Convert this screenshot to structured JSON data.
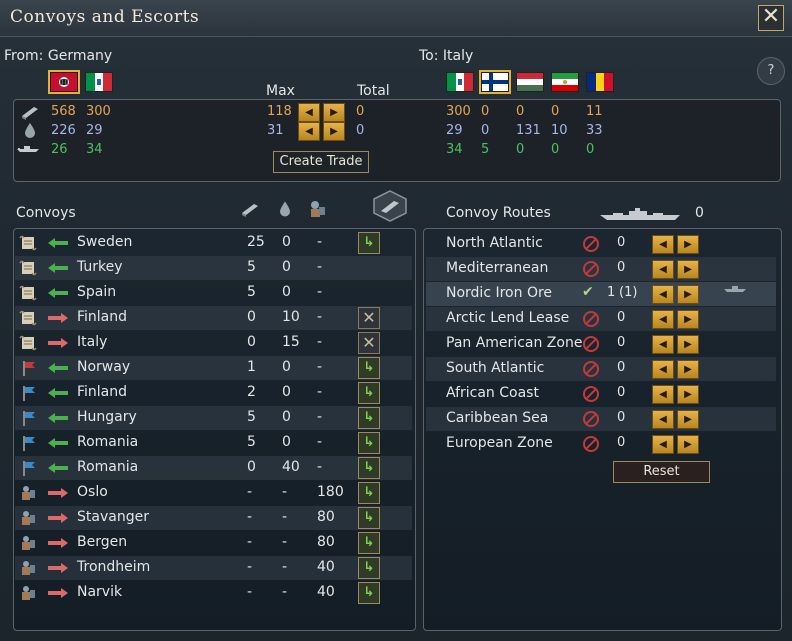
{
  "window": {
    "title": "Convoys and Escorts",
    "close": "✕",
    "help": "?"
  },
  "trade": {
    "from_label": "From: Germany",
    "to_label": "To: Italy",
    "max_label": "Max",
    "total_label": "Total",
    "create_label": "Create Trade",
    "from_cols": [
      [
        "568",
        "300"
      ],
      [
        "226",
        "29"
      ],
      [
        "26",
        "34"
      ]
    ],
    "max": [
      "118",
      "31"
    ],
    "total": [
      "0",
      "0"
    ],
    "to_cols": [
      [
        "300",
        "0",
        "0",
        "0",
        "11"
      ],
      [
        "29",
        "0",
        "131",
        "10",
        "33"
      ],
      [
        "34",
        "5",
        "0",
        "0",
        "0"
      ]
    ]
  },
  "convoys": {
    "title": "Convoys",
    "rows": [
      {
        "name": "Sweden",
        "a": "25",
        "b": "0",
        "c": "-",
        "dir": "in",
        "type": "scroll",
        "action": "go"
      },
      {
        "name": "Turkey",
        "a": "5",
        "b": "0",
        "c": "-",
        "dir": "in",
        "type": "scroll",
        "action": "none"
      },
      {
        "name": "Spain",
        "a": "5",
        "b": "0",
        "c": "-",
        "dir": "in",
        "type": "scroll",
        "action": "none"
      },
      {
        "name": "Finland",
        "a": "0",
        "b": "10",
        "c": "-",
        "dir": "out",
        "type": "scroll",
        "action": "cancel"
      },
      {
        "name": "Italy",
        "a": "0",
        "b": "15",
        "c": "-",
        "dir": "out",
        "type": "scroll",
        "action": "cancel"
      },
      {
        "name": "Norway",
        "a": "1",
        "b": "0",
        "c": "-",
        "dir": "in",
        "type": "flag-red",
        "action": "go"
      },
      {
        "name": "Finland",
        "a": "2",
        "b": "0",
        "c": "-",
        "dir": "in",
        "type": "flag-blue",
        "action": "go"
      },
      {
        "name": "Hungary",
        "a": "5",
        "b": "0",
        "c": "-",
        "dir": "in",
        "type": "flag-blue",
        "action": "go"
      },
      {
        "name": "Romania",
        "a": "5",
        "b": "0",
        "c": "-",
        "dir": "in",
        "type": "flag-blue",
        "action": "go"
      },
      {
        "name": "Romania",
        "a": "0",
        "b": "40",
        "c": "-",
        "dir": "in",
        "type": "flag-blue",
        "action": "go"
      },
      {
        "name": "Oslo",
        "a": "-",
        "b": "-",
        "c": "180",
        "dir": "out",
        "type": "soldier",
        "action": "go"
      },
      {
        "name": "Stavanger",
        "a": "-",
        "b": "-",
        "c": "80",
        "dir": "out",
        "type": "soldier",
        "action": "go"
      },
      {
        "name": "Bergen",
        "a": "-",
        "b": "-",
        "c": "80",
        "dir": "out",
        "type": "soldier",
        "action": "go"
      },
      {
        "name": "Trondheim",
        "a": "-",
        "b": "-",
        "c": "40",
        "dir": "out",
        "type": "soldier",
        "action": "go"
      },
      {
        "name": "Narvik",
        "a": "-",
        "b": "-",
        "c": "40",
        "dir": "out",
        "type": "soldier",
        "action": "go"
      }
    ]
  },
  "routes": {
    "title": "Convoy Routes",
    "ships": "0",
    "reset_label": "Reset",
    "rows": [
      {
        "name": "North Atlantic",
        "count": "0",
        "active": false
      },
      {
        "name": "Mediterranean",
        "count": "0",
        "active": false
      },
      {
        "name": "Nordic Iron Ore",
        "count": "1",
        "extra": "(1)",
        "active": true
      },
      {
        "name": "Arctic Lend Lease",
        "count": "0",
        "active": false
      },
      {
        "name": "Pan American Zone",
        "count": "0",
        "active": false
      },
      {
        "name": "South Atlantic",
        "count": "0",
        "active": false
      },
      {
        "name": "African Coast",
        "count": "0",
        "active": false
      },
      {
        "name": "Caribbean Sea",
        "count": "0",
        "active": false
      },
      {
        "name": "European Zone",
        "count": "0",
        "active": false
      }
    ]
  },
  "colors": {
    "orange": "#e3a552",
    "blue": "#a8b6e8",
    "green": "#4cc060",
    "gold": "#e6b34b"
  }
}
